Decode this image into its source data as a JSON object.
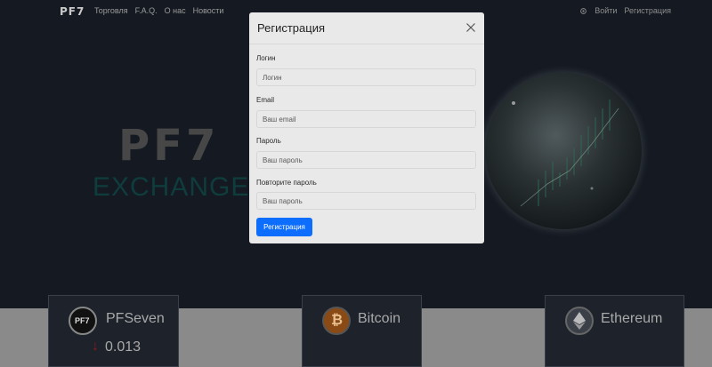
{
  "navbar": {
    "brand": "PF7",
    "links": [
      "Торговля",
      "F.A.Q.",
      "О нас",
      "Новости"
    ],
    "login": "Войти",
    "register": "Регистрация"
  },
  "hero": {
    "logo": "PF7",
    "subtitle": "EXCHANGE"
  },
  "tickers": [
    {
      "name": "PFSeven",
      "price": "0.013",
      "icon": "pf7-coin-icon",
      "coin_label": "PF7",
      "trend": "down"
    },
    {
      "name": "Bitcoin",
      "icon": "bitcoin-icon"
    },
    {
      "name": "Ethereum",
      "icon": "ethereum-icon"
    }
  ],
  "modal": {
    "title": "Регистрация",
    "fields": [
      {
        "label": "Логин",
        "placeholder": "Логин"
      },
      {
        "label": "Email",
        "placeholder": "Ваш email"
      },
      {
        "label": "Пароль",
        "placeholder": "Ваш пароль"
      },
      {
        "label": "Повторите пароль",
        "placeholder": "Ваш пароль"
      }
    ],
    "submit": "Регистрация"
  },
  "colors": {
    "accent": "#0d6efd",
    "background": "#1b2029",
    "modal": "#e9e9e9",
    "price_down": "#8b1d1d"
  }
}
